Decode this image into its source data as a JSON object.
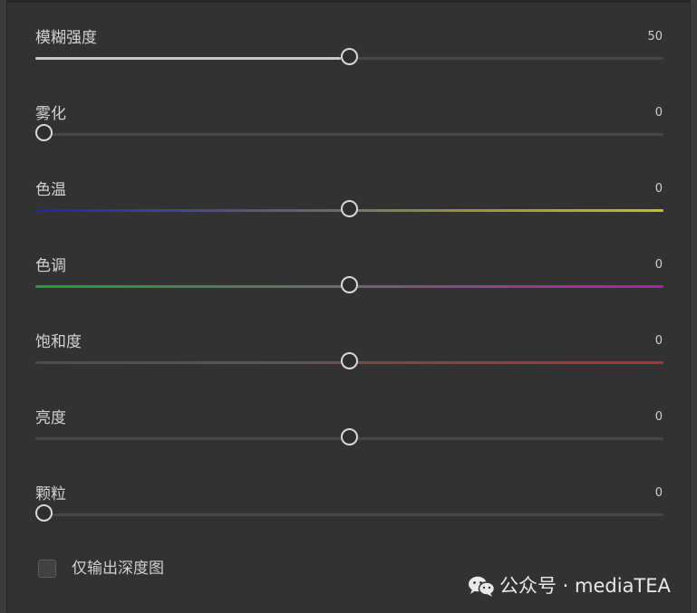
{
  "sliders": [
    {
      "label": "模糊强度",
      "value": "50",
      "position": 0.5,
      "track": "neutral"
    },
    {
      "label": "雾化",
      "value": "0",
      "position": 0.0,
      "track": "plain"
    },
    {
      "label": "色温",
      "value": "0",
      "position": 0.5,
      "track": "temperature"
    },
    {
      "label": "色调",
      "value": "0",
      "position": 0.5,
      "track": "tint"
    },
    {
      "label": "饱和度",
      "value": "0",
      "position": 0.5,
      "track": "saturation"
    },
    {
      "label": "亮度",
      "value": "0",
      "position": 0.5,
      "track": "plain"
    },
    {
      "label": "颗粒",
      "value": "0",
      "position": 0.0,
      "track": "plain"
    }
  ],
  "depth_only": {
    "label": "仅输出深度图",
    "checked": false
  },
  "watermark": {
    "text": "公众号 · mediaTEA",
    "icon": "wechat-icon"
  },
  "colors": {
    "background": "#323232",
    "track": "#464646",
    "thumb_border": "#d8d8d8",
    "temperature_left": "#1b27b5",
    "temperature_right": "#c7c017",
    "tint_left": "#1ca62a",
    "tint_right": "#b31db1",
    "saturation_right": "#b93131",
    "neutral_fill": "#c9c9c9"
  }
}
